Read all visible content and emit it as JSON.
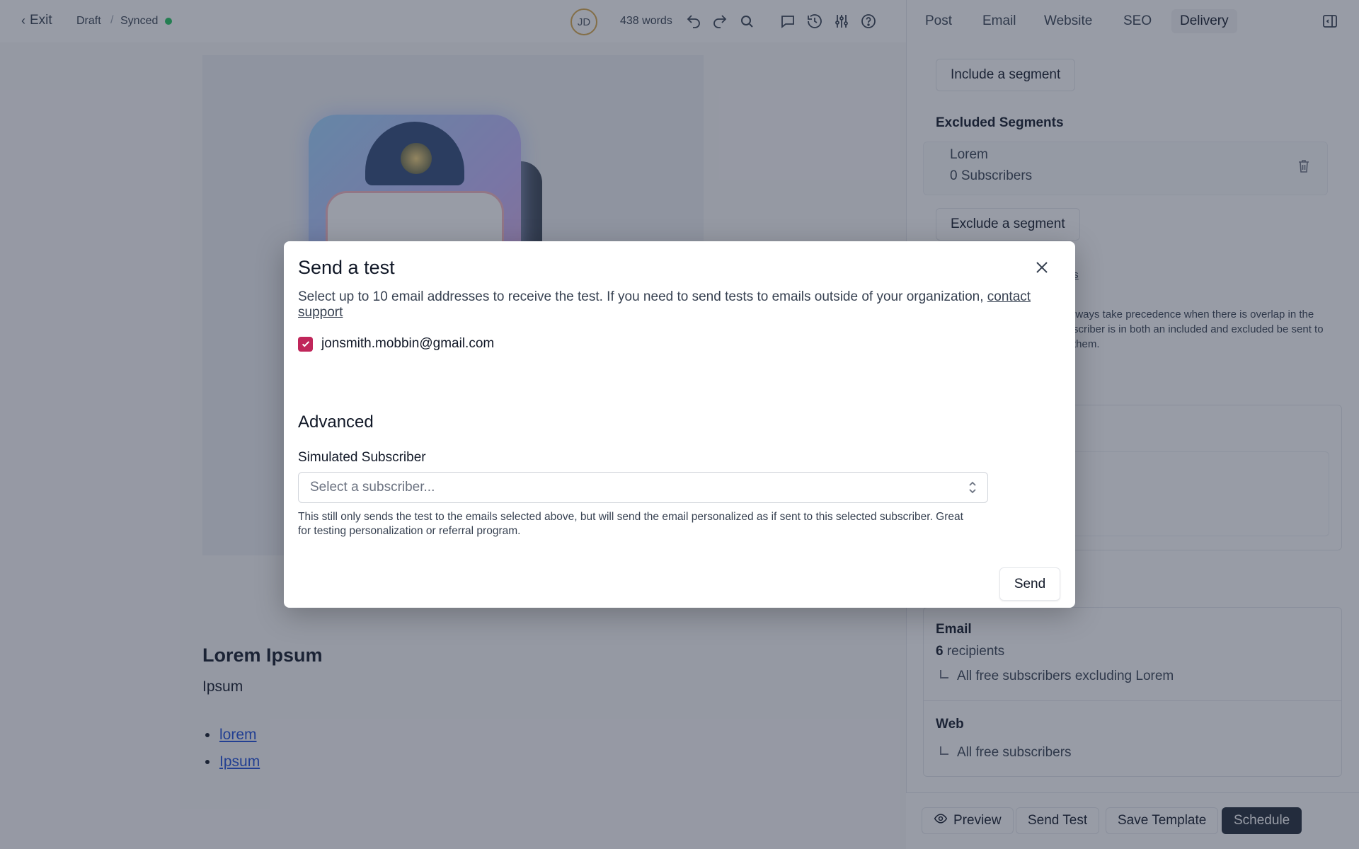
{
  "topbar": {
    "exit_label": "Exit",
    "status": "Draft",
    "separator": "/",
    "sync_status": "Synced",
    "avatar_initials": "JD",
    "word_count": "438 words"
  },
  "editor": {
    "post_title": "Lorem Ipsum",
    "post_subtitle": "Ipsum",
    "links": [
      "lorem",
      "Ipsum"
    ]
  },
  "panel": {
    "tabs": [
      "Post",
      "Email",
      "Website",
      "SEO",
      "Delivery"
    ],
    "active_tab": "Delivery",
    "include_segment_label": "Include a segment",
    "excluded_heading": "Excluded Segments",
    "excluded_segment": {
      "name": "Lorem",
      "count": "0 Subscribers"
    },
    "exclude_segment_label": "Exclude a segment",
    "segments_link_fragment": "ts",
    "precedence_note": "lways take precedence when there is overlap in the scriber is in both an included and excluded be sent to them.",
    "mid_fragment": "ers",
    "email_heading": "Email",
    "email_recipients_count": "6",
    "email_recipients_word": "recipients",
    "email_audience": "All free subscribers excluding Lorem",
    "web_heading": "Web",
    "web_audience": "All free subscribers"
  },
  "footer": {
    "preview_label": "Preview",
    "send_test_label": "Send Test",
    "save_template_label": "Save Template",
    "schedule_label": "Schedule"
  },
  "modal": {
    "title": "Send a test",
    "description": "Select up to 10 email addresses to receive the test. If you need to send tests to emails outside of your organization,",
    "contact_link": "contact support",
    "email_option": "jonsmith.mobbin@gmail.com",
    "email_checked": true,
    "advanced_heading": "Advanced",
    "simulated_label": "Simulated Subscriber",
    "select_placeholder": "Select a subscriber...",
    "help_text": "This still only sends the test to the emails selected above, but will send the email personalized as if sent to this selected subscriber. Great for testing personalization or referral program.",
    "send_label": "Send"
  },
  "colors": {
    "accent_checkbox": "#c0265a",
    "synced_dot": "#22c55e",
    "primary_button": "#1f2937"
  }
}
